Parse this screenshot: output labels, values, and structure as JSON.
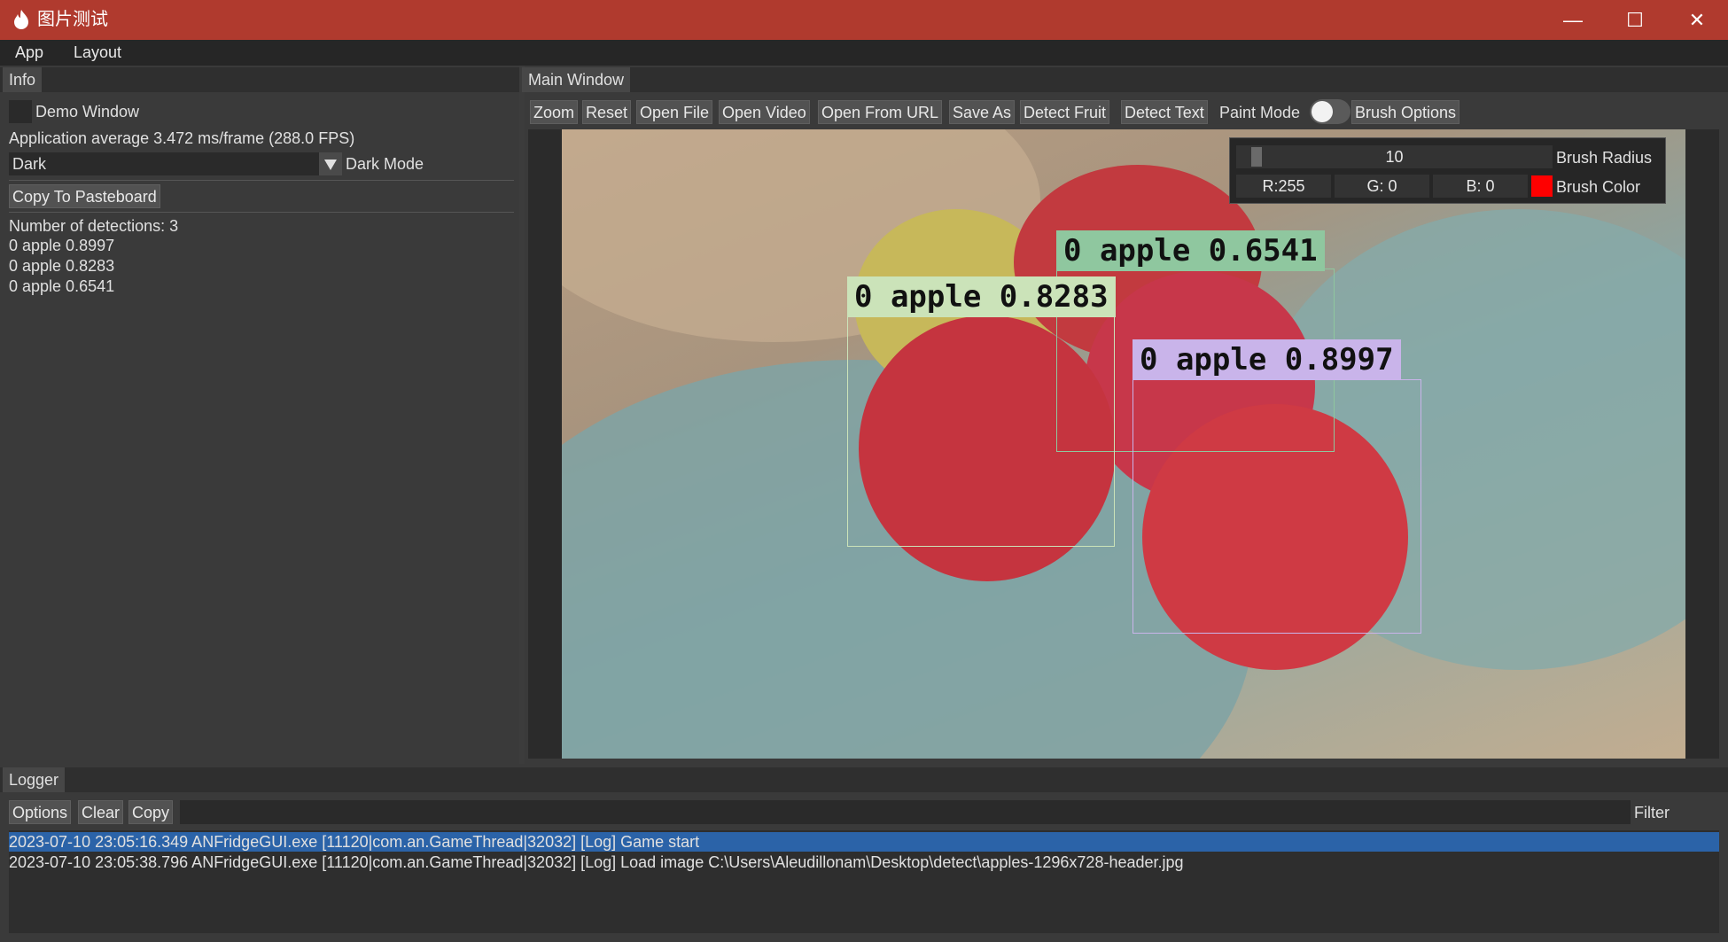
{
  "window": {
    "title": "图片测试",
    "controls": [
      "—",
      "☐",
      "✕"
    ]
  },
  "menu": [
    "App",
    "Layout"
  ],
  "info_panel": {
    "tab": "Info",
    "demo_window_label": "Demo Window",
    "demo_window_checked": false,
    "fps_text": "Application average 3.472 ms/frame (288.0 FPS)",
    "theme_value": "Dark",
    "theme_label": "Dark Mode",
    "copy_button": "Copy To Pasteboard",
    "detections_header": "Number of detections: 3",
    "detections": [
      "0 apple 0.8997",
      "0 apple 0.8283",
      "0 apple 0.6541"
    ]
  },
  "main_window": {
    "tab": "Main Window",
    "toolbar": [
      "Zoom",
      "Reset",
      "Open File",
      "Open Video",
      "Open From URL",
      "Save As",
      "Detect Fruit",
      "Detect Text"
    ],
    "paint_mode_label": "Paint Mode",
    "paint_mode_on": false,
    "brush_options": "Brush Options",
    "brush": {
      "radius_value": "10",
      "radius_level": 0.05,
      "radius_label": "Brush Radius",
      "r": "R:255",
      "g": "G: 0",
      "b": "B: 0",
      "color": "#ff0000",
      "color_label": "Brush Color"
    },
    "detections": [
      {
        "label": "0 apple 0.6541",
        "color": "#8fc79f"
      },
      {
        "label": "0 apple 0.8283",
        "color": "#cbe3b9"
      },
      {
        "label": "0 apple 0.8997",
        "color": "#c9b4ea"
      }
    ]
  },
  "logger": {
    "tab": "Logger",
    "buttons": [
      "Options",
      "Clear",
      "Copy"
    ],
    "filter_value": "",
    "filter_label": "Filter",
    "lines": [
      "2023-07-10 23:05:16.349 ANFridgeGUI.exe [11120|com.an.GameThread|32032] [Log] Game start",
      "2023-07-10 23:05:38.796 ANFridgeGUI.exe [11120|com.an.GameThread|32032] [Log] Load image C:\\Users\\Aleudillonam\\Desktop\\detect\\apples-1296x728-header.jpg"
    ],
    "selected_index": 0
  }
}
